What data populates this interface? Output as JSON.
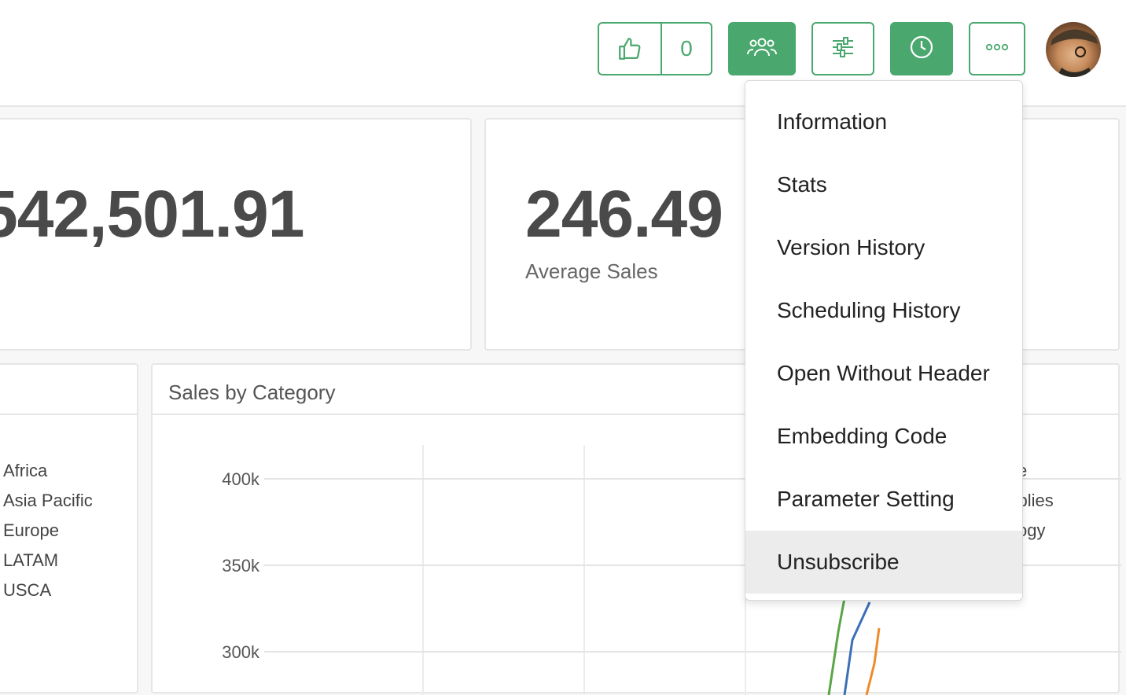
{
  "toolbar": {
    "like_count": "0",
    "icons": [
      "thumbs-up-icon",
      "users-icon",
      "sliders-icon",
      "clock-icon",
      "more-icon"
    ],
    "accent": "#4aa86e"
  },
  "kpis": [
    {
      "value": "542,501.91"
    },
    {
      "value": "246.49",
      "label": "Average Sales"
    }
  ],
  "region_legend": [
    "Africa",
    "Asia Pacific",
    "Europe",
    "LATAM",
    "USCA"
  ],
  "sales_chart": {
    "title": "Sales by Category",
    "category_legend_partial": [
      "e",
      "upplies",
      "ogy"
    ]
  },
  "chart_data": {
    "type": "line",
    "title": "Sales by Category",
    "yticks": [
      "400k",
      "350k",
      "300k"
    ],
    "ylim": [
      280000,
      425000
    ],
    "series": [
      {
        "color": "#5aa546",
        "values": []
      },
      {
        "color": "#3b6fb6",
        "values": []
      },
      {
        "color": "#f08a2c",
        "values": []
      }
    ]
  },
  "menu": {
    "items": [
      "Information",
      "Stats",
      "Version History",
      "Scheduling History",
      "Open Without Header",
      "Embedding Code",
      "Parameter Setting",
      "Unsubscribe"
    ],
    "hovered_index": 7
  }
}
